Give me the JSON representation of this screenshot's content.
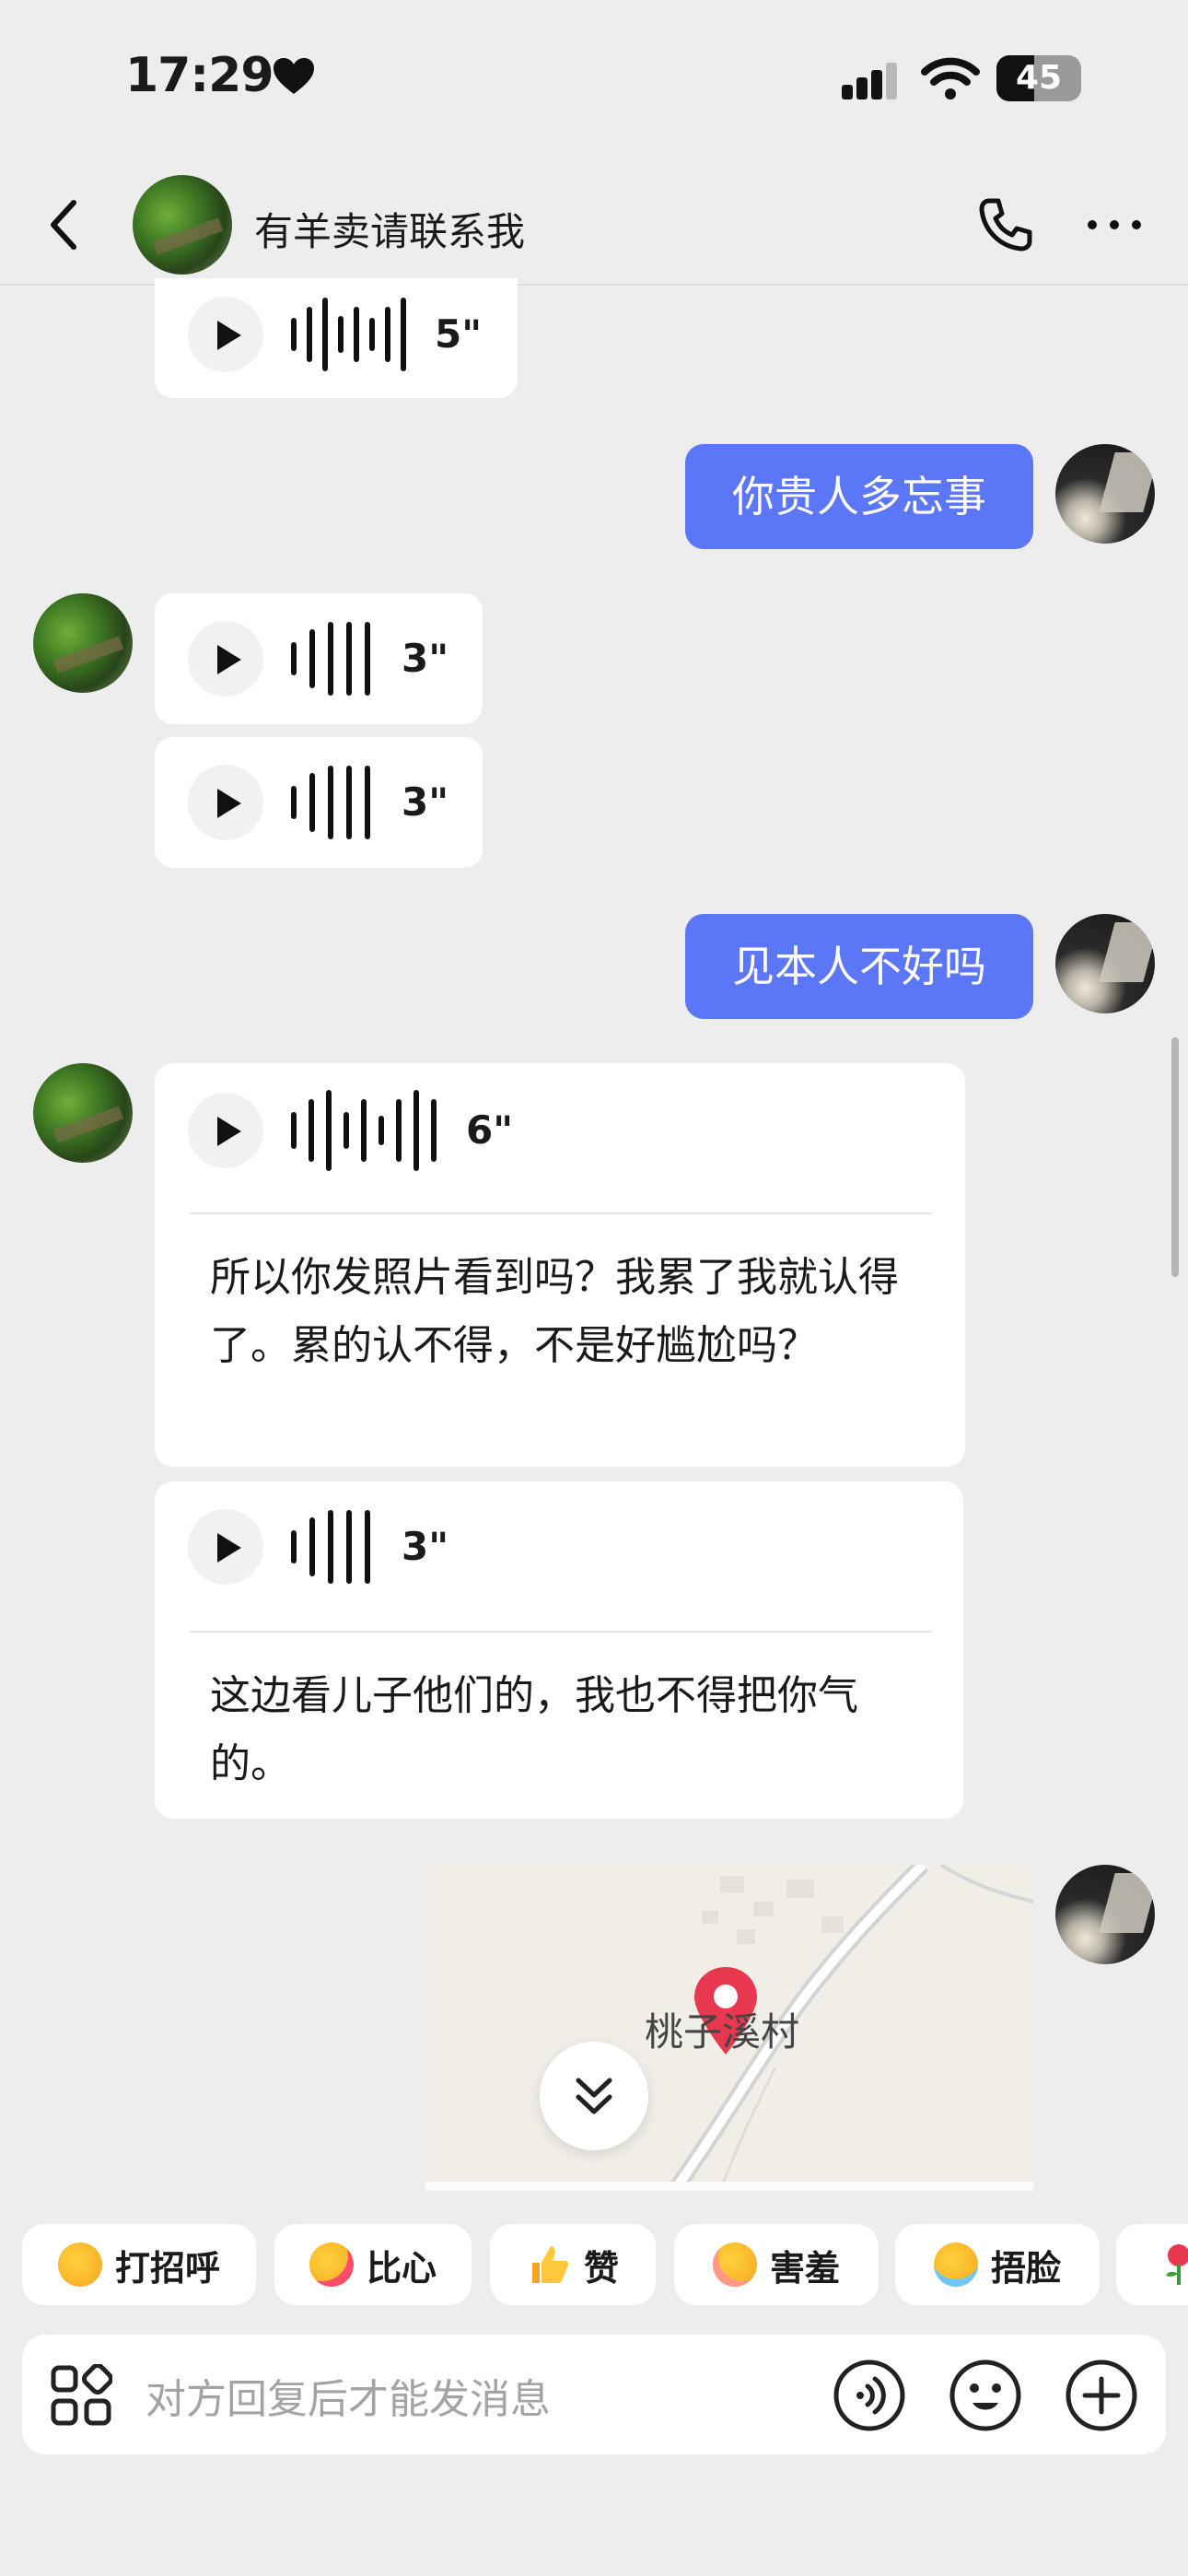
{
  "status_bar": {
    "time": "17:29",
    "battery": "45",
    "battery_level": 0.45
  },
  "header": {
    "title": "有羊卖请联系我"
  },
  "messages": {
    "m1": {
      "duration": "5\""
    },
    "m2": {
      "text": "你贵人多忘事"
    },
    "m3": {
      "duration": "3\""
    },
    "m4": {
      "duration": "3\""
    },
    "m5": {
      "text": "见本人不好吗"
    },
    "m6": {
      "duration": "6\"",
      "transcript": "所以你发照片看到吗？我累了我就认得了。累的认不得，不是好尴尬吗？"
    },
    "m7": {
      "duration": "3\"",
      "transcript": "这边看儿子他们的，我也不得把你气的。"
    },
    "m8": {
      "map_label": "桃子溪村"
    }
  },
  "quick_replies": [
    {
      "label": "打招呼",
      "icon": "greeting-emoji-icon"
    },
    {
      "label": "比心",
      "icon": "heart-hands-emoji-icon"
    },
    {
      "label": "赞",
      "icon": "thumbs-up-emoji-icon"
    },
    {
      "label": "害羞",
      "icon": "shy-emoji-icon"
    },
    {
      "label": "捂脸",
      "icon": "facepalm-emoji-icon"
    },
    {
      "label": "",
      "icon": "rose-emoji-icon"
    }
  ],
  "input": {
    "placeholder": "对方回复后才能发消息"
  },
  "colors": {
    "accent": "#5b76f6",
    "background": "#ededed",
    "map_pin": "#e8384f"
  }
}
